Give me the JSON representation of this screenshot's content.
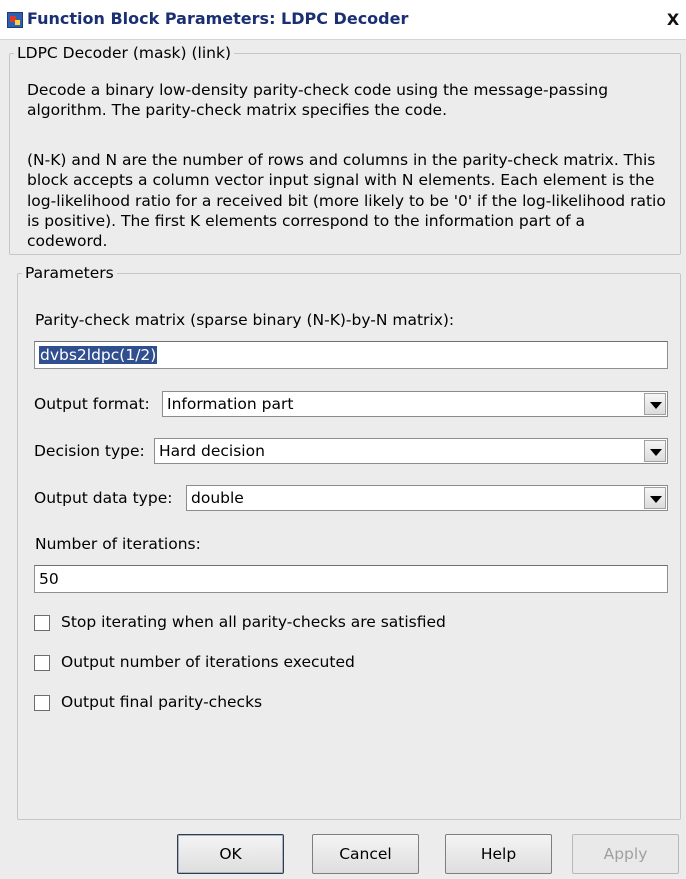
{
  "window": {
    "title": "Function Block Parameters: LDPC Decoder",
    "close_glyph": "X"
  },
  "mask_group": {
    "legend": "LDPC Decoder (mask) (link)",
    "description_1": "Decode a binary low-density parity-check code using the message-passing algorithm. The parity-check matrix specifies the code.",
    "description_2": "(N-K) and N are the number of rows and columns in the parity-check matrix. This block accepts a column vector input signal with N elements. Each element is the log-likelihood ratio for a received bit (more likely to be '0' if the log-likelihood ratio is positive). The first K elements correspond to the information part of a codeword."
  },
  "parameters": {
    "legend": "Parameters",
    "parity_label": "Parity-check matrix (sparse binary (N-K)-by-N matrix):",
    "parity_value": "dvbs2ldpc(1/2)",
    "output_format_label": "Output format:",
    "output_format_value": "Information part",
    "decision_type_label": "Decision type:",
    "decision_type_value": "Hard decision",
    "output_data_type_label": "Output data type:",
    "output_data_type_value": "double",
    "iterations_label": "Number of iterations:",
    "iterations_value": "50",
    "checkboxes": [
      {
        "label": "Stop iterating when all parity-checks are satisfied",
        "checked": false
      },
      {
        "label": "Output number of iterations executed",
        "checked": false
      },
      {
        "label": "Output final parity-checks",
        "checked": false
      }
    ]
  },
  "buttons": {
    "ok": "OK",
    "cancel": "Cancel",
    "help": "Help",
    "apply": "Apply"
  },
  "colors": {
    "selection": "#2f4f8f",
    "title_text": "#1b2f73",
    "dialog_bg": "#ececec"
  },
  "icons": {
    "app": "simulink-block-icon",
    "close": "close-icon",
    "dropdown": "chevron-down-icon"
  }
}
